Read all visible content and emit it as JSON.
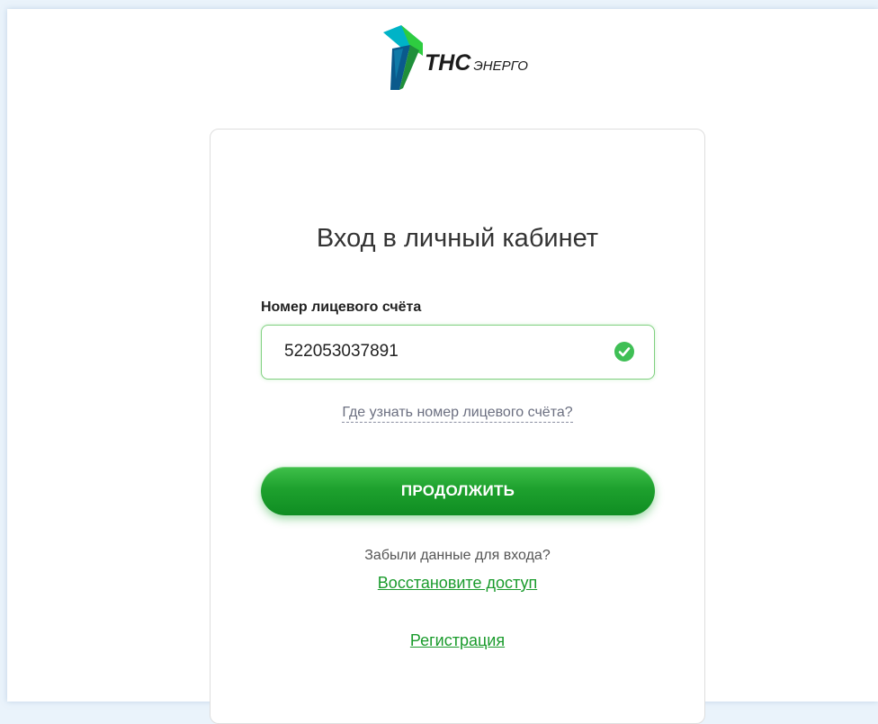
{
  "brand": {
    "name": "ТНС",
    "suffix": "ЭНЕРГО"
  },
  "login": {
    "title": "Вход в личный кабинет",
    "account_label": "Номер лицевого счёта",
    "account_value": "522053037891",
    "help_link": "Где узнать номер лицевого счёта?",
    "continue_button": "ПРОДОЛЖИТЬ",
    "forgot_text": "Забыли данные для входа?",
    "restore_link": "Восстановите доступ",
    "register_link": "Регистрация"
  },
  "colors": {
    "accent": "#1ea12e",
    "link": "#1a9b2c",
    "valid": "#3fbf55"
  },
  "icons": {
    "input_status": "check-circle-icon"
  }
}
